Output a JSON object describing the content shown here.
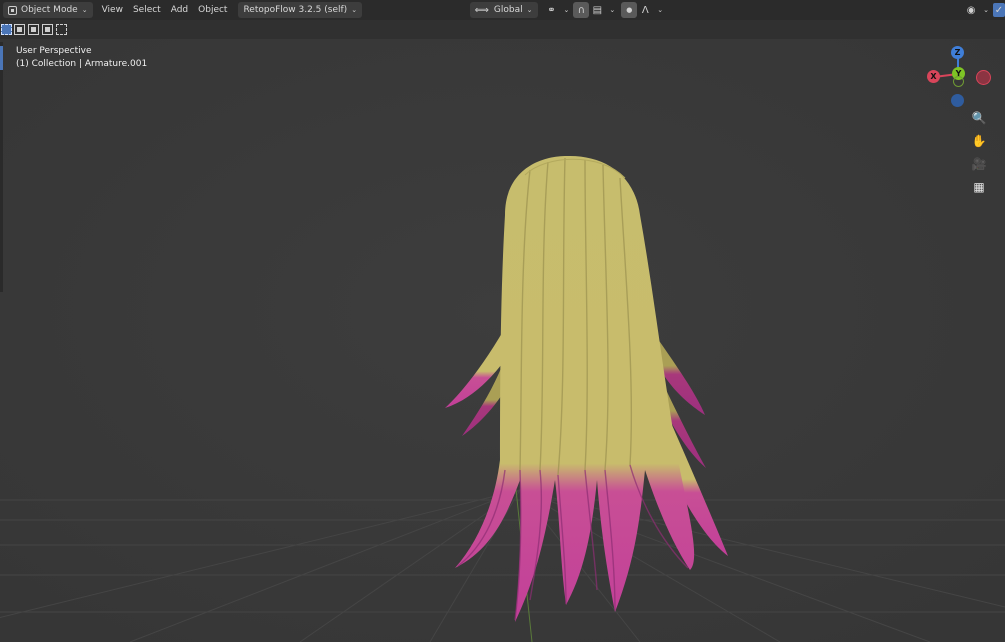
{
  "header": {
    "mode": "Object Mode",
    "menus": [
      "View",
      "Select",
      "Add",
      "Object"
    ],
    "addon": "RetopoFlow 3.2.5 (self)",
    "transform_orientation": "Global"
  },
  "viewport": {
    "view_name": "User Perspective",
    "collection_info": "(1) Collection | Armature.001"
  },
  "gizmo": {
    "axis_z": "Z",
    "axis_y": "Y",
    "axis_x": "X"
  },
  "icons": {
    "zoom": "zoom-icon",
    "pan": "hand-icon",
    "camera": "camera-icon",
    "ortho": "grid-icon"
  },
  "colors": {
    "hair_yellow": "#c9bd6d",
    "hair_pink": "#c8459a",
    "axis_x": "#d8455a",
    "axis_y": "#7ec425",
    "axis_z": "#3f7ed8",
    "select_blue": "#4b76b8"
  }
}
